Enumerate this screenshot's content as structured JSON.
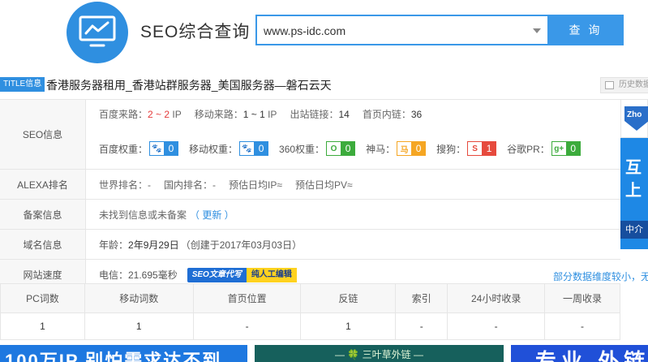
{
  "header": {
    "site_title": "SEO综合查询",
    "search_value": "www.ps-idc.com",
    "search_button": "查 询"
  },
  "title_row": {
    "badge": "TITLE信息",
    "text": "香港服务器租用_香港站群服务器_美国服务器—磐石云天",
    "history": "历史数据"
  },
  "seo": {
    "label": "SEO信息",
    "line1": [
      {
        "k": "百度来路：",
        "v": "2 ~ 2",
        "unit": " IP",
        "red": true
      },
      {
        "k": "移动来路：",
        "v": "1 ~ 1",
        "unit": " IP",
        "red": false
      },
      {
        "k": "出站链接：",
        "v": "14",
        "unit": "",
        "red": false
      },
      {
        "k": "首页内链：",
        "v": "36",
        "unit": "",
        "red": false
      }
    ],
    "weights": [
      {
        "k": "百度权重：",
        "icon": "baidu-paw-icon",
        "glyph": "🐾",
        "v": "0",
        "color": "#2f8fe0"
      },
      {
        "k": "移动权重：",
        "icon": "mobile-paw-icon",
        "glyph": "🐾",
        "v": "0",
        "color": "#2f8fe0"
      },
      {
        "k": "360权重：",
        "icon": "360-icon",
        "glyph": "O",
        "v": "0",
        "color": "#3cab3c"
      },
      {
        "k": "神马：",
        "icon": "shenma-icon",
        "glyph": "马",
        "v": "0",
        "color": "#f5a623"
      },
      {
        "k": "搜狗：",
        "icon": "sogou-icon",
        "glyph": "S",
        "v": "1",
        "color": "#e64a3d"
      },
      {
        "k": "谷歌PR：",
        "icon": "google-plus-icon",
        "glyph": "g+",
        "v": "0",
        "color": "#3cab3c"
      }
    ]
  },
  "alexa": {
    "label": "ALEXA排名",
    "items": [
      "世界排名：-",
      "国内排名：-",
      "预估日均IP≈",
      "预估日均PV≈"
    ]
  },
  "beian": {
    "label": "备案信息",
    "text": "未找到信息或未备案",
    "link": "（ 更新 ）"
  },
  "domain": {
    "label": "域名信息",
    "prefix": "年龄：",
    "age": "2年9月29日",
    "created": "（创建于2017年03月03日）"
  },
  "speed": {
    "label": "网站速度",
    "text": "电信：21.695毫秒",
    "promo1": "SEO文章代写",
    "promo2": "纯人工编辑",
    "note": "部分数据维度较小，无法"
  },
  "stats": {
    "headers": [
      "PC词数",
      "移动词数",
      "首页位置",
      "反链",
      "索引",
      "24小时收录",
      "一周收录"
    ],
    "values": [
      "1",
      "1",
      "-",
      "1",
      "-",
      "-",
      "-"
    ]
  },
  "side_ad": {
    "top": "Zho",
    "line1": "互",
    "line2": "上",
    "line3": "中介"
  },
  "banners": {
    "b1": "100万IP 别怕需求达不到",
    "b2": "— 🍀 三叶草外链 —",
    "b3": "专业 外链"
  }
}
